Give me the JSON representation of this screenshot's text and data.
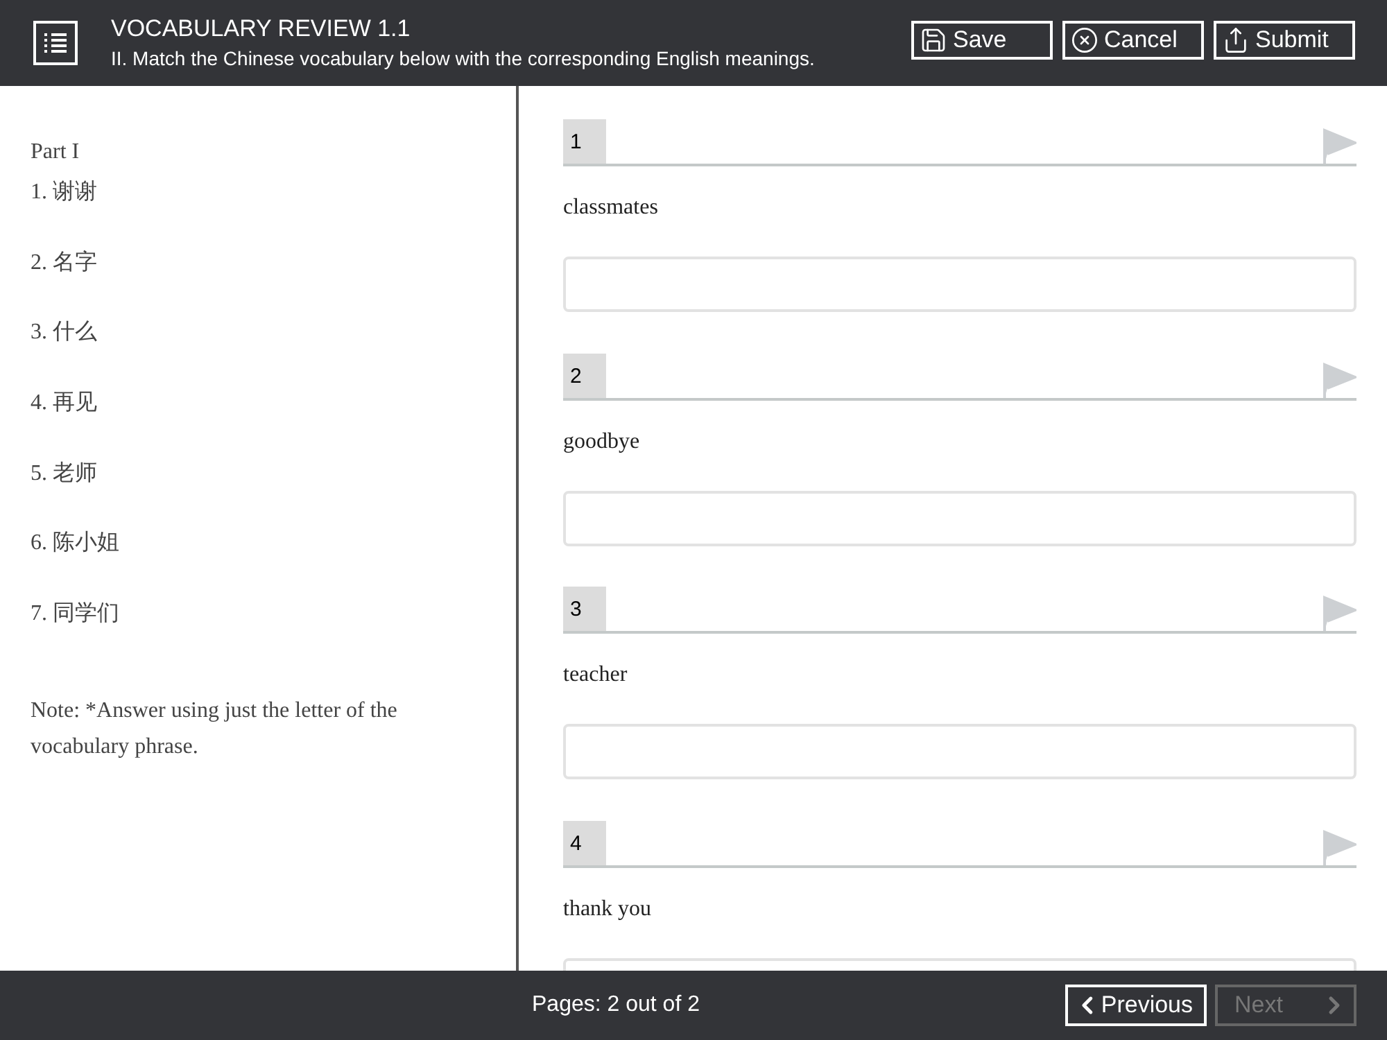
{
  "header": {
    "title": "VOCABULARY REVIEW 1.1",
    "subtitle": "II. Match the Chinese vocabulary below with the corresponding English meanings.",
    "buttons": [
      {
        "kind": "save",
        "label": "Save"
      },
      {
        "kind": "cancel",
        "label": "Cancel"
      },
      {
        "kind": "submit",
        "label": "Submit"
      }
    ]
  },
  "left_panel": {
    "heading": "Part I",
    "items": [
      "1. 谢谢",
      "2. 名字",
      "3. 什么",
      "4. 再见",
      "5. 老师",
      "6. 陈小姐",
      "7. 同学们"
    ],
    "note": "Note: *Answer using just the letter of the vocabulary phrase."
  },
  "questions": [
    {
      "number": "1",
      "prompt": "classmates",
      "flagged": false
    },
    {
      "number": "2",
      "prompt": "goodbye",
      "flagged": false
    },
    {
      "number": "3",
      "prompt": "teacher",
      "flagged": false
    },
    {
      "number": "4",
      "prompt": "thank you",
      "flagged": false
    }
  ],
  "footer": {
    "pages": "Pages: 2 out of 2",
    "previous": {
      "label": "Previous",
      "disabled": false
    },
    "next": {
      "label": "Next",
      "disabled": true
    }
  }
}
